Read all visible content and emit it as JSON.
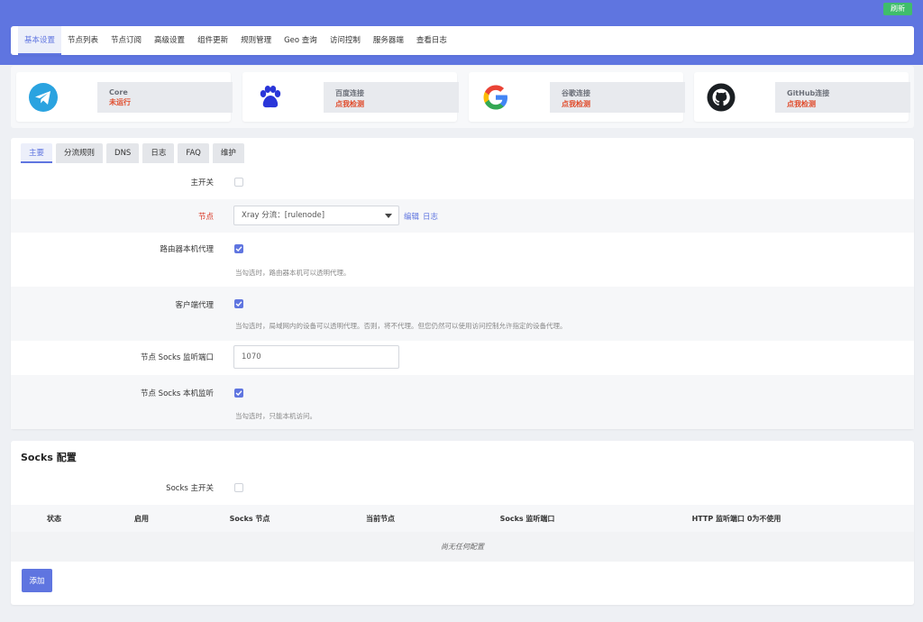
{
  "header": {
    "refresh_label": "刷新"
  },
  "nav": {
    "items": [
      "基本设置",
      "节点列表",
      "节点订阅",
      "高级设置",
      "组件更新",
      "规则管理",
      "Geo 查询",
      "访问控制",
      "服务器端",
      "查看日志"
    ],
    "active_index": 0
  },
  "status_cards": [
    {
      "icon": "telegram-icon",
      "title": "Core",
      "state": "未运行"
    },
    {
      "icon": "baidu-paw-icon",
      "title": "百度连接",
      "state": "点我检测"
    },
    {
      "icon": "google-icon",
      "title": "谷歌连接",
      "state": "点我检测"
    },
    {
      "icon": "github-icon",
      "title": "GitHub连接",
      "state": "点我检测"
    }
  ],
  "subtabs": {
    "items": [
      "主要",
      "分流规则",
      "DNS",
      "日志",
      "FAQ",
      "维护"
    ],
    "active_index": 0
  },
  "form": {
    "master_switch": {
      "label": "主开关",
      "checked": false
    },
    "node": {
      "label": "节点",
      "value": "Xray 分流：[rulenode]",
      "edit_link": "编辑",
      "log_link": "日志"
    },
    "router_proxy": {
      "label": "路由器本机代理",
      "checked": true,
      "hint": "当勾选时，路由器本机可以透明代理。"
    },
    "client_proxy": {
      "label": "客户端代理",
      "checked": true,
      "hint": "当勾选时，局域网内的设备可以透明代理。否则，将不代理。但您仍然可以使用访问控制允许指定的设备代理。"
    },
    "socks_port": {
      "label": "节点 Socks 监听端口",
      "value": "1070"
    },
    "socks_local": {
      "label": "节点 Socks 本机监听",
      "checked": true,
      "hint": "当勾选时，只能本机访问。"
    }
  },
  "socks": {
    "title": "Socks 配置",
    "master_switch_label": "Socks 主开关",
    "columns": [
      "状态",
      "启用",
      "Socks 节点",
      "当前节点",
      "Socks 监听端口",
      "HTTP 监听端口 0为不使用"
    ],
    "empty_text": "尚无任何配置",
    "add_label": "添加"
  },
  "colors": {
    "accent": "#5f75e0",
    "success": "#3fbd6b",
    "danger": "#e04b2b"
  }
}
